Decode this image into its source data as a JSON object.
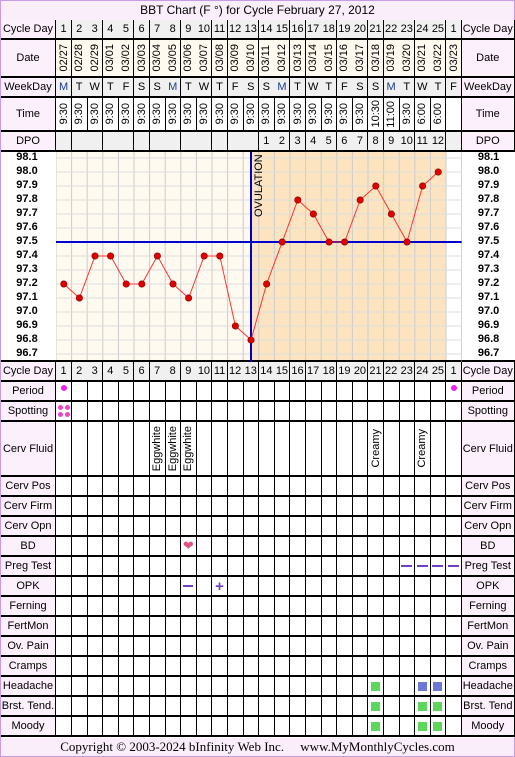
{
  "title": "BBT Chart (F °) for Cycle February 27, 2012",
  "footer": {
    "copyright": "Copyright © 2003-2024 bInfinity Web Inc.",
    "site": "www.MyMonthlyCycles.com"
  },
  "labels": {
    "cycle_day": "Cycle Day",
    "date": "Date",
    "weekday": "WeekDay",
    "time": "Time",
    "dpo": "DPO"
  },
  "cycle_days": [
    "1",
    "2",
    "3",
    "4",
    "5",
    "6",
    "7",
    "8",
    "9",
    "10",
    "11",
    "12",
    "13",
    "14",
    "15",
    "16",
    "17",
    "18",
    "19",
    "20",
    "21",
    "22",
    "23",
    "24",
    "25",
    "1"
  ],
  "dates": [
    "02/27",
    "02/28",
    "02/29",
    "03/01",
    "03/02",
    "03/03",
    "03/04",
    "03/05",
    "03/06",
    "03/07",
    "03/08",
    "03/09",
    "03/10",
    "03/11",
    "03/12",
    "03/13",
    "03/14",
    "03/15",
    "03/16",
    "03/17",
    "03/18",
    "03/19",
    "03/20",
    "03/21",
    "03/22",
    "03/23"
  ],
  "weekdays": [
    "M",
    "T",
    "W",
    "T",
    "F",
    "S",
    "S",
    "M",
    "T",
    "W",
    "T",
    "F",
    "S",
    "S",
    "M",
    "T",
    "W",
    "T",
    "F",
    "S",
    "S",
    "M",
    "T",
    "W",
    "T",
    "F"
  ],
  "times": [
    "9:30",
    "9:30",
    "9:30",
    "9:30",
    "9:30",
    "9:30",
    "9:30",
    "9:30",
    "9:30",
    "9:30",
    "9:30",
    "9:30",
    "9:30",
    "9:30",
    "9:30",
    "9:30",
    "9:30",
    "9:30",
    "9:30",
    "9:30",
    "10:30",
    "11:00",
    "9:30",
    "6:00",
    "6:00",
    ""
  ],
  "dpo": [
    "",
    "",
    "",
    "",
    "",
    "",
    "",
    "",
    "",
    "",
    "",
    "",
    "",
    "1",
    "2",
    "3",
    "4",
    "5",
    "6",
    "7",
    "8",
    "9",
    "10",
    "11",
    "12",
    ""
  ],
  "chart_data": {
    "type": "line",
    "y_ticks": [
      "98.1",
      "98.0",
      "97.9",
      "97.8",
      "97.7",
      "97.6",
      "97.5",
      "97.4",
      "97.3",
      "97.2",
      "97.1",
      "97.0",
      "96.9",
      "96.8",
      "96.7"
    ],
    "ylim": [
      96.7,
      98.1
    ],
    "temperatures": [
      97.2,
      97.1,
      97.4,
      97.4,
      97.2,
      97.2,
      97.4,
      97.2,
      97.1,
      97.4,
      97.4,
      96.9,
      96.8,
      97.2,
      97.5,
      97.8,
      97.7,
      97.5,
      97.5,
      97.8,
      97.9,
      97.7,
      97.5,
      97.9,
      98.0,
      null
    ],
    "coverline": 97.5,
    "ovulation_day": 13,
    "ovulation_label": "OVULATION",
    "colors": {
      "line": "#ff3333",
      "point": "#e00000",
      "coverline": "#0000cc",
      "pre_bg": "#fffaef",
      "post_bg": "#fbe4bf"
    }
  },
  "rows": [
    {
      "label": "Period",
      "marks": {
        "0": "period-dot",
        "25": "period-dot"
      }
    },
    {
      "label": "Spotting",
      "marks": {
        "0": "spotting-dots"
      }
    },
    {
      "label": "Cerv Fluid",
      "tall": true,
      "texts": {
        "6": "Eggwhite",
        "7": "Eggwhite",
        "8": "Eggwhite",
        "20": "Creamy",
        "23": "Creamy"
      }
    },
    {
      "label": "Cerv Pos"
    },
    {
      "label": "Cerv Firm"
    },
    {
      "label": "Cerv Opn"
    },
    {
      "label": "BD",
      "marks": {
        "8": "heart"
      }
    },
    {
      "label": "Preg Test",
      "marks": {
        "22": "dash",
        "23": "dash",
        "24": "dash",
        "25": "dash"
      }
    },
    {
      "label": "OPK",
      "marks": {
        "8": "minus",
        "10": "plus"
      }
    },
    {
      "label": "Ferning"
    },
    {
      "label": "FertMon"
    },
    {
      "label": "Ov. Pain"
    },
    {
      "label": "Cramps"
    },
    {
      "label": "Headache",
      "marks": {
        "20": "green-square",
        "23": "blue-square",
        "24": "blue-square"
      }
    },
    {
      "label": "Brst. Tend.",
      "right_label": "Brst. Tend",
      "marks": {
        "20": "green-square",
        "23": "green-square",
        "24": "green-square"
      }
    },
    {
      "label": "Moody",
      "marks": {
        "20": "green-square",
        "23": "green-square",
        "24": "green-square"
      }
    }
  ]
}
